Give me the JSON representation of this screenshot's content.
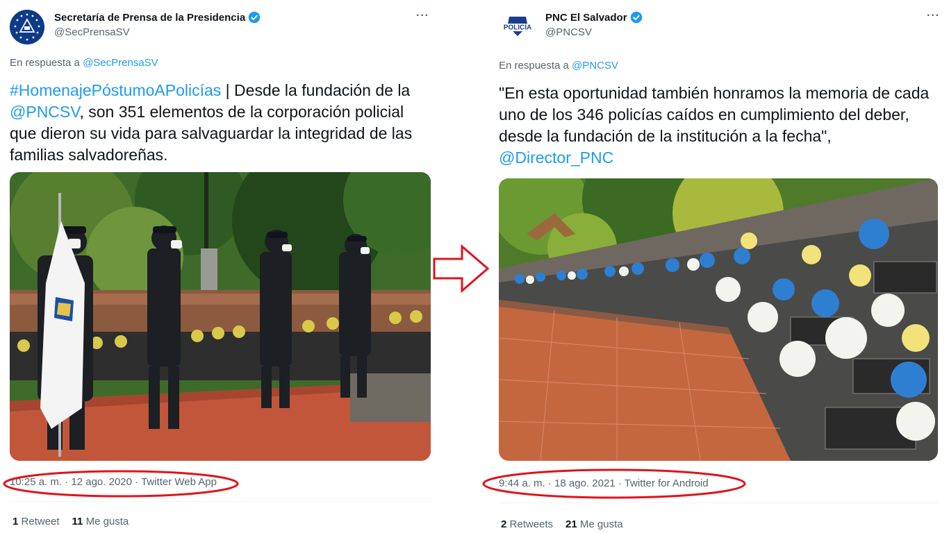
{
  "left": {
    "account": {
      "name": "Secretaría de Prensa de la Presidencia",
      "handle": "@SecPrensaSV"
    },
    "more_label": "···",
    "reply_prefix": "En respuesta a",
    "reply_mention": "@SecPrensaSV",
    "text": {
      "hashtag": "#HomenajePóstumoAPolicías",
      "part1": " | Desde la fundación de la ",
      "mention": "@PNCSV",
      "part2": ", son 351 elementos de la corporación policial que dieron su vida para salvaguardar la integridad de las familias salvadoreñas."
    },
    "meta": {
      "time": "10:25 a. m.",
      "date": "12 ago. 2020",
      "source": "Twitter Web App",
      "sep": " · "
    },
    "stats": {
      "retweets_count": "1",
      "retweets_label": "Retweet",
      "likes_count": "11",
      "likes_label": "Me gusta"
    }
  },
  "right": {
    "account": {
      "name": "PNC El Salvador",
      "handle": "@PNCSV",
      "avatar_text": "POLICÍA"
    },
    "more_label": "···",
    "reply_prefix": "En respuesta a",
    "reply_mention": "@PNCSV",
    "text": {
      "part1": "\"En esta oportunidad también honramos la memoria de cada uno de los 346 policías caídos en cumplimiento del deber, desde la fundación de la institución a la fecha\", ",
      "mention": "@Director_PNC"
    },
    "meta": {
      "time": "9:44 a. m.",
      "date": "18 ago. 2021",
      "source": "Twitter for Android",
      "sep": " · "
    },
    "stats": {
      "retweets_count": "2",
      "retweets_label": "Retweets",
      "likes_count": "21",
      "likes_label": "Me gusta"
    }
  },
  "colors": {
    "link": "#1d9bf0",
    "verified": "#1d9bf0",
    "annotation": "#e0131b",
    "muted": "#536471"
  }
}
